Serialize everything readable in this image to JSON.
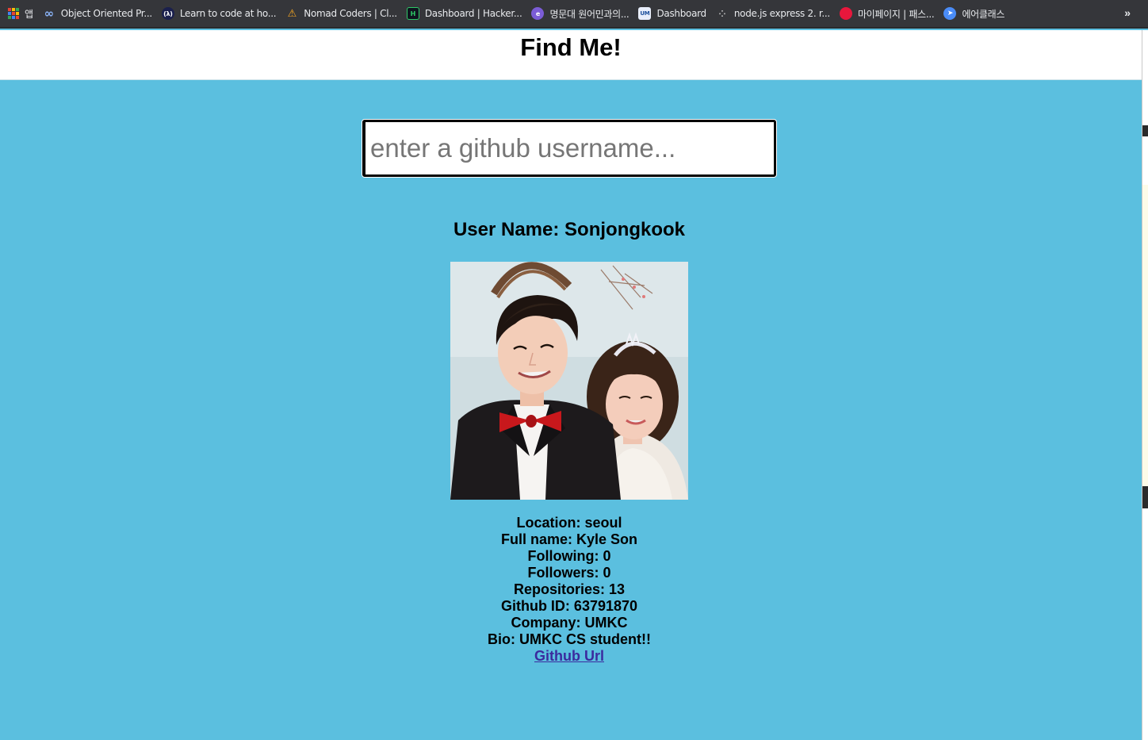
{
  "bookmarks": [
    {
      "label": "앱",
      "icon": "apps-grid-icon"
    },
    {
      "label": "Object Oriented Pr...",
      "icon": "infinity-icon"
    },
    {
      "label": "Learn to code at ho...",
      "icon": "lambda-icon"
    },
    {
      "label": "Nomad Coders | Cl...",
      "icon": "nomad-icon"
    },
    {
      "label": "Dashboard | Hacker...",
      "icon": "hackerrank-icon"
    },
    {
      "label": "명문대 원어민과의...",
      "icon": "purple-chat-icon"
    },
    {
      "label": "Dashboard",
      "icon": "umkc-icon"
    },
    {
      "label": "node.js express 2. r...",
      "icon": "dots-icon"
    },
    {
      "label": "마이페이지 | 패스...",
      "icon": "red-circle-icon"
    },
    {
      "label": "에어클래스",
      "icon": "blue-arrow-icon"
    }
  ],
  "bookmarks_more": "»",
  "header": {
    "title": "Find Me!"
  },
  "search": {
    "placeholder": "enter a github username...",
    "value": ""
  },
  "profile": {
    "username": "User Name: Sonjongkook",
    "location": "Location: seoul",
    "full_name": "Full name: Kyle Son",
    "following": "Following: 0",
    "followers": "Followers: 0",
    "repositories": "Repositories: 13",
    "github_id": "Github ID: 63791870",
    "company": "Company: UMKC",
    "bio": "Bio: UMKC CS student!!",
    "github_url_label": "Github Url"
  },
  "colors": {
    "background": "#5bbfdf",
    "header": "#ffffff",
    "link": "#3b2a9e",
    "bookmark_bar": "#35363a"
  }
}
